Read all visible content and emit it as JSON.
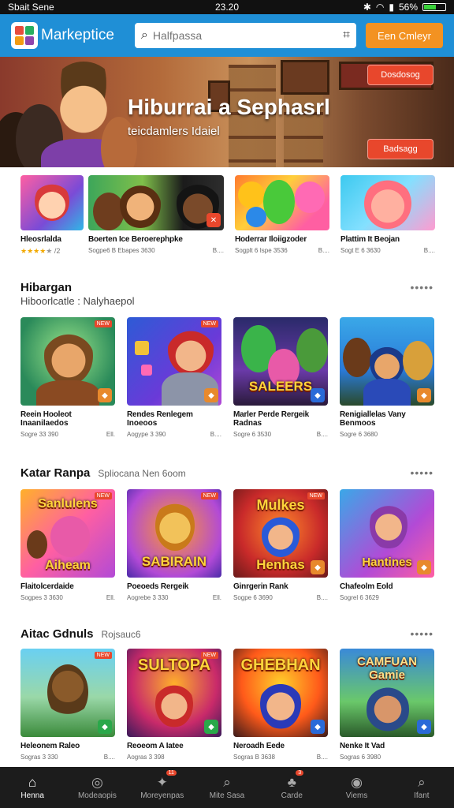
{
  "status_bar": {
    "left": "Sbait  Sene",
    "time": "23.20",
    "battery": "56%",
    "battery_level": 0.56
  },
  "header": {
    "app_name": "Markeptice",
    "search_placeholder": "Halfpassa",
    "cta_label": "Een Cmleyr",
    "brand_color": "#1f8fd6",
    "cta_color": "#f39221"
  },
  "hero": {
    "title": "Hiburrai a Sephasrl",
    "subtitle": "teicdamlers Idaiel",
    "button_top": "Dosdosog",
    "button_bottom": "Badsagg"
  },
  "featured": {
    "items": [
      {
        "title": "Hleosrlalda",
        "meta_left": "",
        "meta_right": "",
        "rating": 4
      },
      {
        "title": "Boerten Ice Beroerephpke",
        "meta_left": "Sogpe6 B Ebapes 3630",
        "meta_right": ""
      },
      {
        "title": "",
        "meta_left": "",
        "meta_right": "B...."
      },
      {
        "title": "Hoderrar Iloiigzoder",
        "meta_left": "Sogplt 6 Ispe 3536",
        "meta_right": "B...."
      },
      {
        "title": "Plattim It Beojan",
        "meta_left": "Sogt E 6 3630",
        "meta_right": "B...."
      }
    ]
  },
  "sections": [
    {
      "title": "Hibargan",
      "subtitle": "Hiboorlcatle : Nalyhaepol",
      "more": "•••••",
      "items": [
        {
          "title": "Reein Hooleot",
          "title2": "Inaanilaedos",
          "meta_left": "Sogre 33 390",
          "meta_right": "Ell."
        },
        {
          "title": "Rendes Renlegem",
          "title2": "Inoeoos",
          "meta_left": "Aogype 3 390",
          "meta_right": "B...."
        },
        {
          "title": "Marler Perde Rergeik",
          "title2": "Radnas",
          "meta_left": "Sogre 6 3530",
          "meta_right": "B...."
        },
        {
          "title": "Renigiallelas Vany",
          "title2": "Benmoos",
          "meta_left": "Sogre 6 3680",
          "meta_right": ""
        }
      ]
    },
    {
      "title": "Katar Ranpa",
      "subtitle": "Spliocana Nen 6oom",
      "more": "•••••",
      "items": [
        {
          "title": "Flaitolcerdaide",
          "meta_left": "Sogpes 3 3630",
          "meta_right": "Ell."
        },
        {
          "title": "Poeoeds Rergeik",
          "meta_left": "Aogrebe 3 330",
          "meta_right": "Ell."
        },
        {
          "title": "Ginrgerin Rank",
          "meta_left": "Sogpe 6 3690",
          "meta_right": "B...."
        },
        {
          "title": "Chafeolm Eold",
          "meta_left": "Sogrel 6 3629",
          "meta_right": ""
        }
      ]
    },
    {
      "title": "Aitac Gdnuls",
      "subtitle": "Rojsauc6",
      "more": "•••••",
      "items": [
        {
          "title": "Heleonem Raleo",
          "meta_left": "Sogras 3 330",
          "meta_right": "B...."
        },
        {
          "title": "Reoeom A Iatee",
          "meta_left": "Aogras 3 398",
          "meta_right": ""
        },
        {
          "title": "Neroadh Eede",
          "meta_left": "Sogras B 3638",
          "meta_right": "B...."
        },
        {
          "title": "Nenke It Vad",
          "meta_left": "Sogras 6 3980",
          "meta_right": ""
        }
      ]
    }
  ],
  "thumbs_text": {
    "s1": [
      "",
      "",
      "SALEERS",
      ""
    ],
    "s2": [
      "Sanlulens Aiheam",
      "SABIRAIN",
      "Mulkes Henhas",
      "Hantines"
    ],
    "s3": [
      "",
      "SULTOPA",
      "GHEBHAN",
      "CAMFUAN Gamie"
    ]
  },
  "bottom_nav": [
    {
      "label": "Henna",
      "icon": "home-icon",
      "glyph": "⌂",
      "badge": ""
    },
    {
      "label": "Modeaopis",
      "icon": "compass-icon",
      "glyph": "◎",
      "badge": ""
    },
    {
      "label": "Moreyenpas",
      "icon": "puzzle-icon",
      "glyph": "✦",
      "badge": "11"
    },
    {
      "label": "Mite Sasa",
      "icon": "search-icon",
      "glyph": "⌕",
      "badge": ""
    },
    {
      "label": "Carde",
      "icon": "cart-icon",
      "glyph": "♣",
      "badge": "3"
    },
    {
      "label": "Viems",
      "icon": "view-icon",
      "glyph": "◉",
      "badge": ""
    },
    {
      "label": "Ifant",
      "icon": "profile-icon",
      "glyph": "⌕",
      "badge": ""
    }
  ]
}
